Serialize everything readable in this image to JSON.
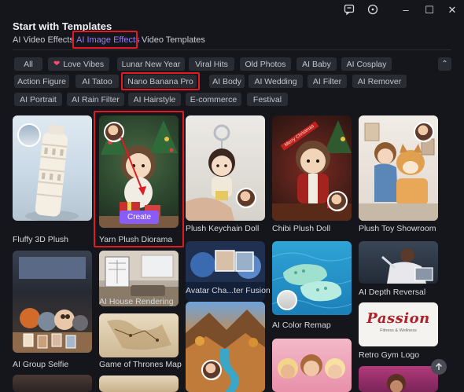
{
  "window": {
    "controls": {
      "feedback": "feedback-icon",
      "info": "info-icon",
      "minimize": "–",
      "maximize": "☐",
      "close": "✕"
    }
  },
  "header": {
    "title": "Start with Templates"
  },
  "tabs": [
    {
      "label": "AI Video Effects"
    },
    {
      "label": "AI Image Effects",
      "active": true
    },
    {
      "label": "Video Templates"
    }
  ],
  "chips": {
    "row1": [
      "All",
      "Love Vibes",
      "Lunar New Year",
      "Viral Hits",
      "Old Photos",
      "AI Baby",
      "AI Cosplay"
    ],
    "row2": [
      "Action Figure",
      "AI Tatoo",
      "Nano Banana Pro",
      "AI Body",
      "AI Wedding",
      "AI Filter",
      "AI Remover"
    ],
    "row3": [
      "AI Portrait",
      "AI Rain Filter",
      "AI Hairstyle",
      "E-commerce",
      "Festival"
    ],
    "collapse_glyph": "⌃"
  },
  "cards": [
    {
      "label": "Fluffy 3D Plush"
    },
    {
      "label": "Yarn Plush Diorama",
      "action": "Create"
    },
    {
      "label": "Plush Keychain Doll"
    },
    {
      "label": "Chibi Plush Doll"
    },
    {
      "label": "Plush Toy Showroom"
    },
    {
      "label": "AI House Rendering"
    },
    {
      "label": "Avatar Cha...ter Fusion"
    },
    {
      "label": "AI Depth Reversal"
    },
    {
      "label": "AI Color Remap"
    },
    {
      "label": "Retro Gym Logo"
    },
    {
      "label": "AI Group Selfie"
    },
    {
      "label": "Game of Thrones Map"
    }
  ],
  "thumbnail_text": {
    "chibi_ribbon": "Merry Christmas",
    "gym_logo": "Passion",
    "gym_logo_sub": "Fitness & Wellness"
  },
  "colors": {
    "accent": "#8a6dff",
    "highlight": "#e01b24",
    "create_button": "#8a5cf6"
  }
}
